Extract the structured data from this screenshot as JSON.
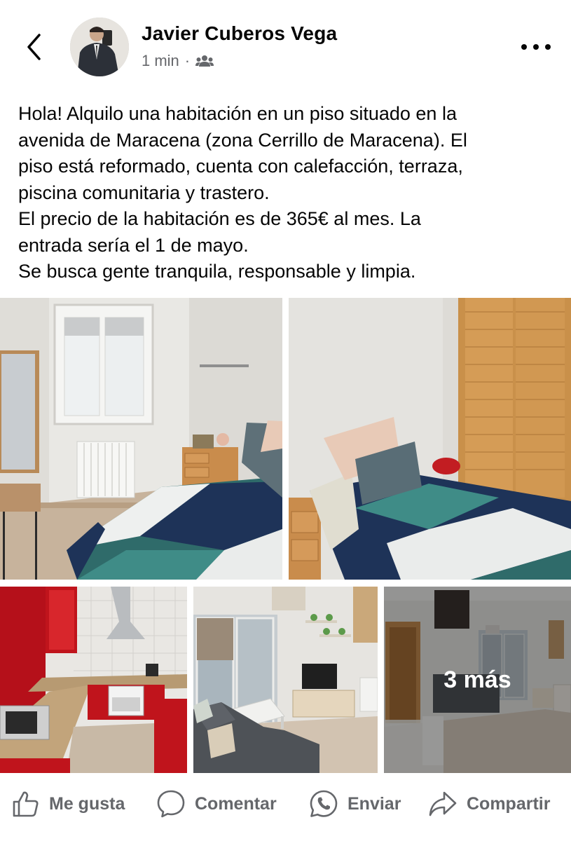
{
  "post": {
    "author": "Javier Cuberos Vega",
    "time": "1 min",
    "separator": "·",
    "audience_icon": "friends-icon",
    "text_lines": [
      "Hola! Alquilo una habitación en un piso situado en la",
      "avenida de Maracena (zona Cerrillo de Maracena). El",
      "piso está reformado, cuenta con calefacción, terraza,",
      "piscina comunitaria y trastero.",
      "El precio de la habitación es de 365€ al mes. La",
      "entrada sería el 1 de mayo.",
      "Se busca gente tranquila, responsable y limpia."
    ]
  },
  "photos": {
    "more_label": "3 más",
    "items": [
      "bedroom-window",
      "bedroom-wardrobe",
      "kitchen",
      "living-room",
      "living-room-wide"
    ]
  },
  "actions": {
    "like": "Me gusta",
    "comment": "Comentar",
    "send": "Enviar",
    "share": "Compartir"
  },
  "colors": {
    "text": "#050505",
    "secondary": "#65676b",
    "kitchen_red": "#c0141c",
    "wood": "#c9904a",
    "bedspread_teal": "#2f6b6a",
    "bedspread_navy": "#1e3358"
  }
}
